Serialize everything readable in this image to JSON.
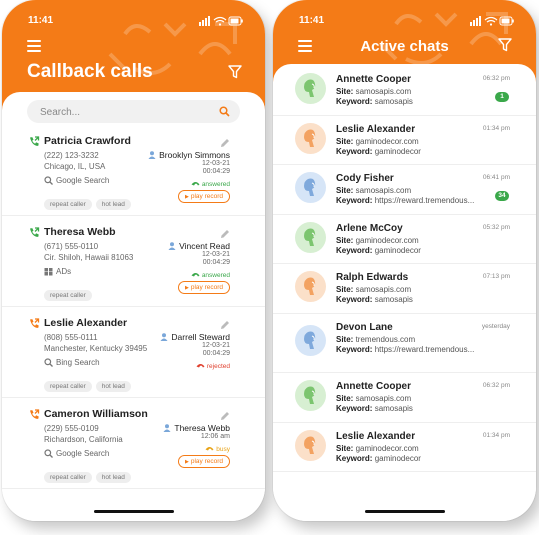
{
  "status_time": "11:41",
  "callback": {
    "title": "Callback calls",
    "search_placeholder": "Search...",
    "calls": [
      {
        "name": "Patricia Crawford",
        "phone": "(222) 123-3232",
        "address": "Chicago, IL, USA",
        "source": "Google Search",
        "source_icon": "search-icon",
        "tags": [
          "repeat caller",
          "hot lead"
        ],
        "agent": "Brooklyn Simmons",
        "date": "12-03-21",
        "time": "00:04:29",
        "status": "answered",
        "status_color": "#3aa84a",
        "call_icon_color": "#3aa84a",
        "has_play": true,
        "play_label": "play record"
      },
      {
        "name": "Theresa Webb",
        "phone": "(671) 555-0110",
        "address": "Cir. Shiloh, Hawaii 81063",
        "source": "ADs",
        "source_icon": "ads-icon",
        "tags": [
          "repeat caller"
        ],
        "agent": "Vincent Read",
        "date": "12-03-21",
        "time": "00:04:29",
        "status": "answered",
        "status_color": "#3aa84a",
        "call_icon_color": "#3aa84a",
        "has_play": true,
        "play_label": "play record"
      },
      {
        "name": "Leslie Alexander",
        "phone": "(808) 555-0111",
        "address": "Manchester, Kentucky 39495",
        "source": "Bing Search",
        "source_icon": "search-icon",
        "tags": [
          "repeat caller",
          "hot lead"
        ],
        "agent": "Darrell Steward",
        "date": "12-03-21",
        "time": "00:04:29",
        "status": "rejected",
        "status_color": "#e0412f",
        "call_icon_color": "#f47b17",
        "has_play": false,
        "play_label": ""
      },
      {
        "name": "Cameron Williamson",
        "phone": "(229) 555-0109",
        "address": "Richardson, California",
        "source": "Google Search",
        "source_icon": "search-icon",
        "tags": [
          "repeat caller",
          "hot lead"
        ],
        "agent": "Theresa Webb",
        "date": "12:06 am",
        "time": "",
        "status": "busy",
        "status_color": "#e8a317",
        "call_icon_color": "#f47b17",
        "has_play": true,
        "play_label": "play record"
      }
    ]
  },
  "chats": {
    "title": "Active chats",
    "site_label": "Site:",
    "keyword_label": "Keyword:",
    "items": [
      {
        "name": "Annette Cooper",
        "site": "samosapis.com",
        "keyword": "samosapis",
        "time": "06:32 pm",
        "badge": "1",
        "avatar_color": "green"
      },
      {
        "name": "Leslie Alexander",
        "site": "gaminodecor.com",
        "keyword": "gaminodecor",
        "time": "01:34 pm",
        "badge": "",
        "avatar_color": "orange"
      },
      {
        "name": "Cody Fisher",
        "site": "samosapis.com",
        "keyword": "https://reward.tremendous...",
        "time": "06:41 pm",
        "badge": "34",
        "avatar_color": "blue"
      },
      {
        "name": "Arlene McCoy",
        "site": "gaminodecor.com",
        "keyword": "gaminodecor",
        "time": "05:32 pm",
        "badge": "",
        "avatar_color": "green"
      },
      {
        "name": "Ralph Edwards",
        "site": "samosapis.com",
        "keyword": "samosapis",
        "time": "07:13 pm",
        "badge": "",
        "avatar_color": "orange"
      },
      {
        "name": "Devon Lane",
        "site": "tremendous.com",
        "keyword": "https://reward.tremendous...",
        "time": "yesterday",
        "badge": "",
        "avatar_color": "blue"
      },
      {
        "name": "Annette Cooper",
        "site": "samosapis.com",
        "keyword": "samosapis",
        "time": "06:32 pm",
        "badge": "",
        "avatar_color": "green"
      },
      {
        "name": "Leslie Alexander",
        "site": "gaminodecor.com",
        "keyword": "gaminodecor",
        "time": "01:34 pm",
        "badge": "",
        "avatar_color": "orange"
      }
    ]
  },
  "colors": {
    "accent": "#f47b17",
    "answered": "#3aa84a",
    "rejected": "#e0412f",
    "busy": "#e8a317",
    "badge": "#3aa84a"
  }
}
